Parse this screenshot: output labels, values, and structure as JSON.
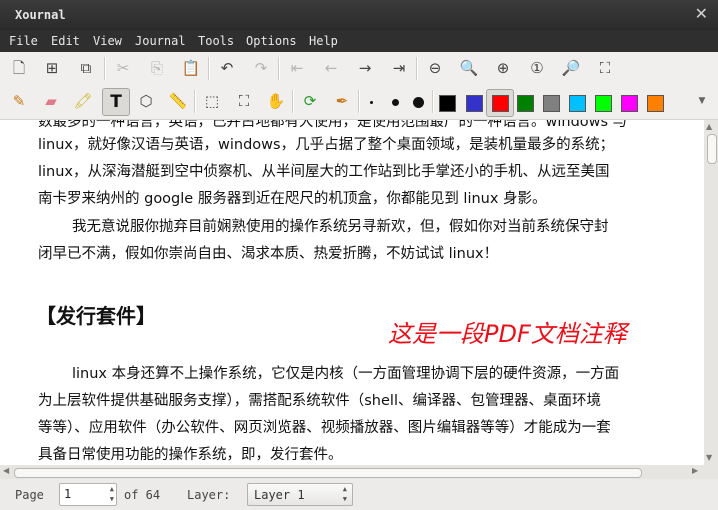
{
  "window": {
    "title": "Xournal",
    "close_glyph": "✕"
  },
  "menu": [
    "File",
    "Edit",
    "View",
    "Journal",
    "Tools",
    "Options",
    "Help"
  ],
  "toolbar1": [
    {
      "name": "new-page-icon",
      "glyph": "🗋",
      "dim": false
    },
    {
      "name": "add-page-icon",
      "glyph": "⊞",
      "dim": false
    },
    {
      "name": "duplicate-page-icon",
      "glyph": "⧉",
      "dim": false
    },
    {
      "name": "cut-icon",
      "glyph": "✂",
      "dim": true
    },
    {
      "name": "copy-icon",
      "glyph": "⎘",
      "dim": true
    },
    {
      "name": "paste-icon",
      "glyph": "📋",
      "dim": false
    },
    {
      "name": "undo-icon",
      "glyph": "↶",
      "dim": false
    },
    {
      "name": "redo-icon",
      "glyph": "↷",
      "dim": true
    },
    {
      "name": "first-page-icon",
      "glyph": "⇤",
      "dim": true
    },
    {
      "name": "previous-page-icon",
      "glyph": "←",
      "dim": true
    },
    {
      "name": "next-page-icon",
      "glyph": "→",
      "dim": false
    },
    {
      "name": "last-page-icon",
      "glyph": "⇥",
      "dim": false
    },
    {
      "name": "zoom-out-icon",
      "glyph": "⊖",
      "dim": false
    },
    {
      "name": "zoom-fit-icon",
      "glyph": "🔍",
      "dim": false
    },
    {
      "name": "zoom-in-icon",
      "glyph": "⊕",
      "dim": false
    },
    {
      "name": "zoom-100-icon",
      "glyph": "①",
      "dim": false
    },
    {
      "name": "zoom-custom-icon",
      "glyph": "🔎",
      "dim": false
    },
    {
      "name": "fullscreen-icon",
      "glyph": "⛶",
      "dim": false
    }
  ],
  "toolbar2": [
    {
      "name": "pen-icon",
      "glyph": "✎",
      "active": false
    },
    {
      "name": "eraser-icon",
      "glyph": "▰",
      "active": false
    },
    {
      "name": "highlighter-icon",
      "glyph": "🖍",
      "active": false
    },
    {
      "name": "text-tool-icon",
      "glyph": "T",
      "active": true
    },
    {
      "name": "shape-recognizer-icon",
      "glyph": "⬡",
      "active": false
    },
    {
      "name": "ruler-icon",
      "glyph": "📏",
      "active": false
    },
    {
      "name": "select-rectangle-icon",
      "glyph": "⬚",
      "active": false
    },
    {
      "name": "select-region-icon",
      "glyph": "⛶",
      "active": false
    },
    {
      "name": "hand-tool-icon",
      "glyph": "✋",
      "active": false
    },
    {
      "name": "default-tool-icon",
      "glyph": "⟳",
      "active": false
    },
    {
      "name": "default-pen-icon",
      "glyph": "✒",
      "active": false
    }
  ],
  "colors": [
    "#000000",
    "#3333cc",
    "#ff0000",
    "#008000",
    "#808080",
    "#00c0ff",
    "#00ff00",
    "#ff00ff",
    "#ff8000"
  ],
  "selected_color_index": 2,
  "toolbar_more_glyph": "▼",
  "document": {
    "line0": "数最多的一种语言，英语，已并占地都有大使用，是使用范围最广的一种语言。windows 与",
    "line1": "linux，就好像汉语与英语，windows，几乎占据了整个桌面领域，是装机量最多的系统；",
    "line2": "linux，从深海潜艇到空中侦察机、从半间屋大的工作站到比手掌还小的手机、从远至美国",
    "line3": "南卡罗来纳州的 google 服务器到近在咫尺的机顶盒，你都能见到 linux 身影。",
    "line4": "我无意说服你抛弃目前娴熟使用的操作系统另寻新欢，但，假如你对当前系统保守封",
    "line5": "闭早已不满，假如你崇尚自由、渴求本质、热爱折腾，不妨试试 linux！",
    "heading": "【发行套件】",
    "annotation": "这是一段PDF文档注释",
    "line6": "linux 本身还算不上操作系统，它仅是内核（一方面管理协调下层的硬件资源，一方面",
    "line7": "为上层软件提供基础服务支撑），需搭配系统软件（shell、编译器、包管理器、桌面环境",
    "line8": "等等）、应用软件（办公软件、网页浏览器、视频播放器、图片编辑器等等）才能成为一套",
    "line9": "具备日常使用功能的操作系统，即，发行套件。"
  },
  "status": {
    "page_label": "Page",
    "page_value": "1",
    "of_label": "of 64",
    "layer_label": "Layer:",
    "layer_value": "Layer 1"
  }
}
